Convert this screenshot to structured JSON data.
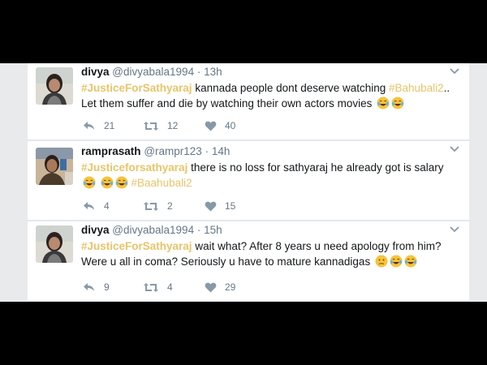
{
  "tweets": [
    {
      "name": "divya",
      "handle": "@divyabala1994",
      "time": "13h",
      "hashtag": "#JusticeForSathyaraj",
      "text1": "kannada people dont deserve watching",
      "hashtag2": "#Bahubali2",
      "text2": ".. Let them suffer and die by watching their own actors movies",
      "replies": "21",
      "retweets": "12",
      "likes": "40"
    },
    {
      "name": "ramprasath",
      "handle": "@rampr123",
      "time": "14h",
      "hashtag": "#Justiceforsathyaraj",
      "text1": "there is no loss for sathyaraj he already got is salary",
      "hashtag2": "#Baahubali2",
      "replies": "4",
      "retweets": "2",
      "likes": "15"
    },
    {
      "name": "divya",
      "handle": "@divyabala1994",
      "time": "15h",
      "hashtag": "#JusticeForSathyaraj",
      "text1": "wait what?  After 8 years u need apology from him? Were u all in coma?  Seriously u have to mature kannadigas",
      "replies": "9",
      "retweets": "4",
      "likes": "29"
    }
  ],
  "icons": {
    "reply": "reply-icon",
    "retweet": "retweet-icon",
    "like": "heart-icon",
    "caret": "chevron-down-icon",
    "emoji": "joy-emoji-icon"
  },
  "colors": {
    "hashtag": "#e8c46a",
    "text": "#14171a",
    "muted": "#657786"
  }
}
